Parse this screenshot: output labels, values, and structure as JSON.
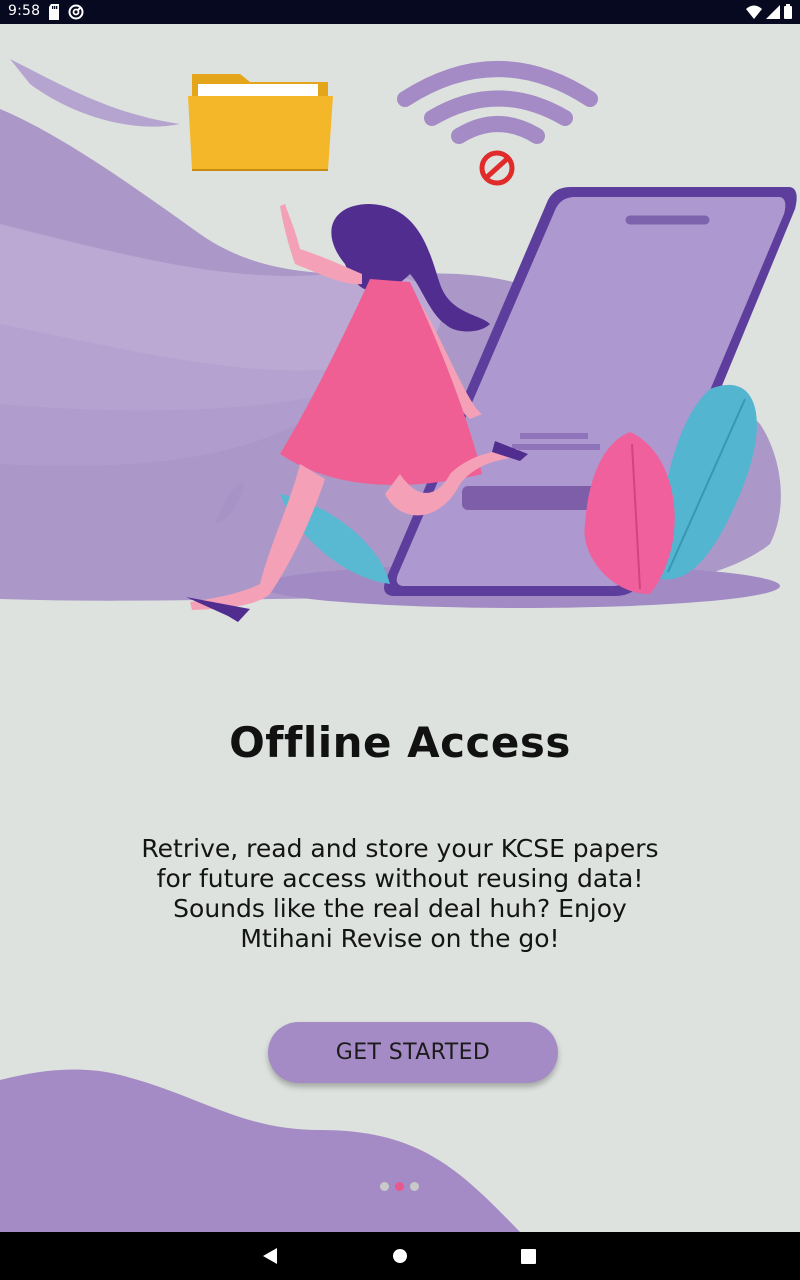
{
  "status_bar": {
    "time": "9:58",
    "left_icons": [
      "sd-card-icon",
      "sync-icon"
    ],
    "right_icons": [
      "wifi-icon",
      "signal-icon",
      "battery-icon"
    ]
  },
  "onboarding": {
    "title": "Offline Access",
    "description_lines": [
      "Retrive, read and store your KCSE papers",
      "for future access without reusing data!",
      "Sounds like the real deal huh? Enjoy",
      "Mtihani Revise on the go!"
    ],
    "cta_label": "GET STARTED",
    "pager": {
      "total": 3,
      "active_index": 1
    }
  },
  "illustration": {
    "icons": [
      "folder-icon",
      "wifi-off-icon",
      "phone-icon",
      "woman-figure",
      "leaf-icon"
    ]
  },
  "colors": {
    "background": "#dde2de",
    "accent_purple": "#a58bc5",
    "accent_pink": "#e8588e",
    "status_bar": "#06091f"
  },
  "nav_bar": {
    "buttons": [
      "back-icon",
      "home-icon",
      "recents-icon"
    ]
  }
}
